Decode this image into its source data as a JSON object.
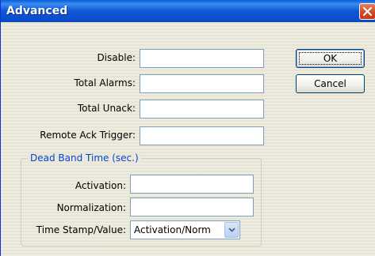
{
  "window": {
    "title": "Advanced"
  },
  "fields": {
    "disable_label": "Disable:",
    "total_alarms_label": "Total Alarms:",
    "total_unack_label": "Total Unack:",
    "remote_ack_label": "Remote Ack Trigger:",
    "disable_value": "",
    "total_alarms_value": "",
    "total_unack_value": "",
    "remote_ack_value": ""
  },
  "buttons": {
    "ok": "OK",
    "cancel": "Cancel"
  },
  "deadband": {
    "group_label": "Dead Band Time (sec.)",
    "activation_label": "Activation:",
    "normalization_label": "Normalization:",
    "timestamp_label": "Time Stamp/Value:",
    "activation_value": "",
    "normalization_value": "",
    "timestamp_selected": "Activation/Norm"
  },
  "icons": {
    "close": "close-icon",
    "dropdown": "chevron-down-icon"
  },
  "colors": {
    "titlebar": "#0a5fd8",
    "close": "#d5431f",
    "group_label": "#0046d5",
    "field_border": "#7f9db9"
  }
}
